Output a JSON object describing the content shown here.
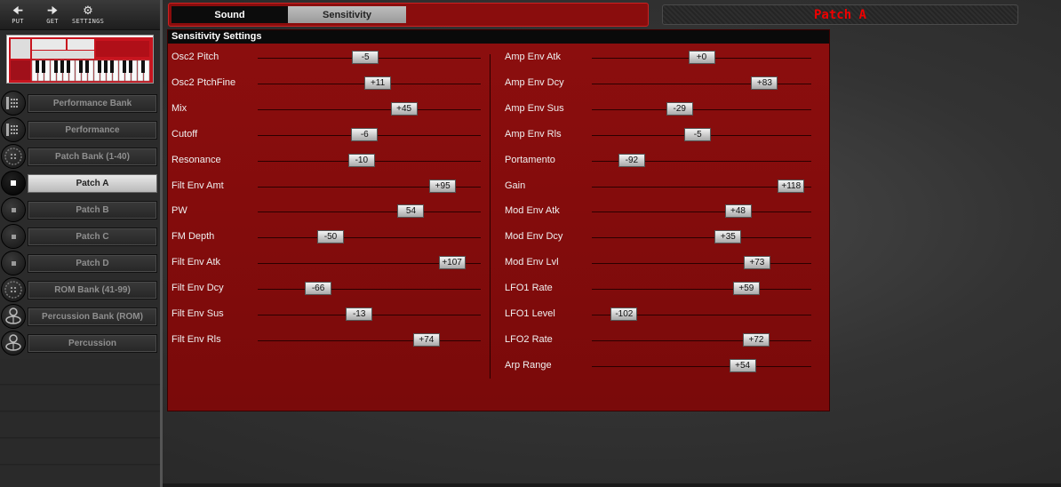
{
  "toolbar": {
    "put": {
      "label": "PUT",
      "icon": "arrow-left-icon"
    },
    "get": {
      "label": "GET",
      "icon": "arrow-right-icon"
    },
    "settings": {
      "label": "SETTINGS",
      "icon": "gear-icon"
    }
  },
  "nav": [
    {
      "label": "Performance Bank",
      "icon": "bank-grid-icon",
      "active": false
    },
    {
      "label": "Performance",
      "icon": "performance-grid-icon",
      "active": false
    },
    {
      "label": "Patch Bank (1-40)",
      "icon": "patch-bank-icon",
      "active": false
    },
    {
      "label": "Patch A",
      "icon": "patch-slot-icon",
      "active": true
    },
    {
      "label": "Patch B",
      "icon": "patch-slot-icon",
      "active": false
    },
    {
      "label": "Patch C",
      "icon": "patch-slot-icon",
      "active": false
    },
    {
      "label": "Patch D",
      "icon": "patch-slot-icon",
      "active": false
    },
    {
      "label": "ROM Bank (41-99)",
      "icon": "rom-bank-icon",
      "active": false
    },
    {
      "label": "Percussion Bank (ROM)",
      "icon": "drum-kit-icon",
      "active": false
    },
    {
      "label": "Percussion",
      "icon": "drum-icon",
      "active": false
    }
  ],
  "tabs": {
    "sound": "Sound",
    "sensitivity": "Sensitivity"
  },
  "patch_display": "Patch A",
  "panel": {
    "title": "Sensitivity Settings",
    "min": -127,
    "max": 127,
    "left": [
      {
        "label": "Osc2 Pitch",
        "value": "-5"
      },
      {
        "label": "Osc2 PtchFine",
        "value": "+11"
      },
      {
        "label": "Mix",
        "value": "+45"
      },
      {
        "label": "Cutoff",
        "value": "-6"
      },
      {
        "label": "Resonance",
        "value": "-10"
      },
      {
        "label": "Filt Env Amt",
        "value": "+95"
      },
      {
        "label": "PW",
        "value": "54"
      },
      {
        "label": "FM Depth",
        "value": "-50"
      },
      {
        "label": "Filt Env Atk",
        "value": "+107"
      },
      {
        "label": "Filt Env Dcy",
        "value": "-66"
      },
      {
        "label": "Filt Env Sus",
        "value": "-13"
      },
      {
        "label": "Filt Env Rls",
        "value": "+74"
      }
    ],
    "right": [
      {
        "label": "Amp Env Atk",
        "value": "+0"
      },
      {
        "label": "Amp Env Dcy",
        "value": "+83"
      },
      {
        "label": "Amp Env Sus",
        "value": "-29"
      },
      {
        "label": "Amp Env Rls",
        "value": "-5"
      },
      {
        "label": "Portamento",
        "value": "-92"
      },
      {
        "label": "Gain",
        "value": "+118"
      },
      {
        "label": "Mod Env Atk",
        "value": "+48"
      },
      {
        "label": "Mod Env Dcy",
        "value": "+35"
      },
      {
        "label": "Mod Env Lvl",
        "value": "+73"
      },
      {
        "label": "LFO1 Rate",
        "value": "+59"
      },
      {
        "label": "LFO1 Level",
        "value": "-102"
      },
      {
        "label": "LFO2 Rate",
        "value": "+72"
      },
      {
        "label": "Arp Range",
        "value": "+54"
      }
    ]
  },
  "colors": {
    "panel_red": "#8c0e0e",
    "accent_red": "#e00000",
    "header_black": "#0a0a0a"
  }
}
